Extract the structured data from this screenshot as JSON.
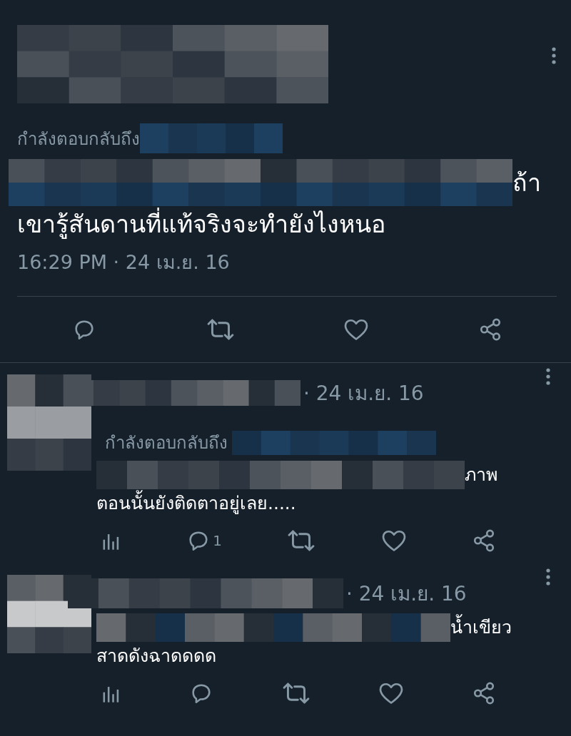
{
  "main_tweet": {
    "reply_prefix": "กำลังตอบกลับถึง",
    "text_end": "ถ้า",
    "text_line": "เขารู้สันดานที่แท้จริงจะทำยังไงหนอ",
    "timestamp": "16:29 PM · 24 เม.ย. 16",
    "actions": [
      {
        "kind": "reply"
      },
      {
        "kind": "retweet"
      },
      {
        "kind": "like"
      },
      {
        "kind": "share"
      }
    ]
  },
  "replies": [
    {
      "date": "· 24 เม.ย. 16",
      "reply_prefix": "กำลังตอบกลับถึง",
      "text_end": "ภาพ",
      "text_line": "ตอนนั้นยังติดตาอยู่เลย.....",
      "actions": [
        {
          "kind": "stats"
        },
        {
          "kind": "reply",
          "count": "1"
        },
        {
          "kind": "retweet"
        },
        {
          "kind": "like"
        },
        {
          "kind": "share"
        }
      ]
    },
    {
      "date": "· 24 เม.ย. 16",
      "text_end": "น้ำเขียว",
      "text_line": "สาดดังฉาดดดด",
      "actions": [
        {
          "kind": "stats"
        },
        {
          "kind": "reply"
        },
        {
          "kind": "retweet"
        },
        {
          "kind": "like"
        },
        {
          "kind": "share"
        }
      ]
    }
  ]
}
